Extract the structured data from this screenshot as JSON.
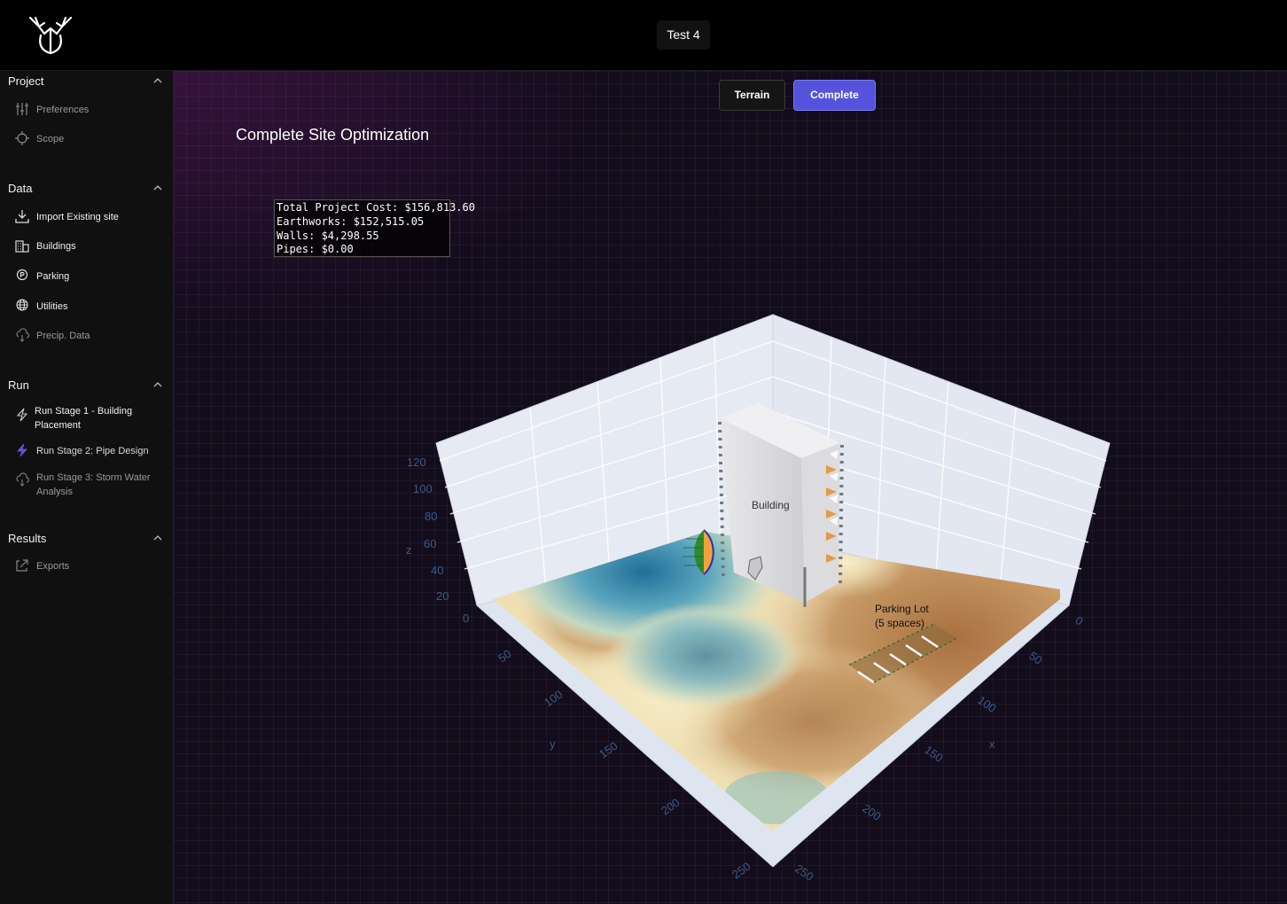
{
  "header": {
    "project_name": "Test 4"
  },
  "sidebar": {
    "sections": [
      {
        "title": "Project",
        "items": [
          {
            "label": "Preferences",
            "icon": "sliders-icon"
          },
          {
            "label": "Scope",
            "icon": "crosshair-icon"
          }
        ]
      },
      {
        "title": "Data",
        "items": [
          {
            "label": "Import Existing site",
            "icon": "download-icon"
          },
          {
            "label": "Buildings",
            "icon": "building-icon"
          },
          {
            "label": "Parking",
            "icon": "parking-icon"
          },
          {
            "label": "Utilities",
            "icon": "globe-icon"
          },
          {
            "label": "Precip. Data",
            "icon": "cloud-icon"
          }
        ]
      },
      {
        "title": "Run",
        "items": [
          {
            "label": "Run Stage 1 - Building Placement",
            "icon": "bolt-icon"
          },
          {
            "label": "Run Stage 2: Pipe Design",
            "icon": "bolt-icon"
          },
          {
            "label": "Run Stage 3: Storm Water Analysis",
            "icon": "cloud-icon"
          }
        ]
      },
      {
        "title": "Results",
        "items": [
          {
            "label": "Exports",
            "icon": "export-icon"
          }
        ]
      }
    ]
  },
  "toolbar": {
    "terrain_label": "Terrain",
    "complete_label": "Complete"
  },
  "plot": {
    "title": "Complete Site Optimization",
    "costs": {
      "total": "Total Project Cost: $156,813.60",
      "earthworks": "Earthworks: $152,515.05",
      "walls": "Walls: $4,298.55",
      "pipes": "Pipes: $0.00"
    },
    "building_label": "Building",
    "parking_label_line1": "Parking Lot",
    "parking_label_line2": "(5 spaces)",
    "axes": {
      "x_title": "x",
      "y_title": "y",
      "z_title": "z",
      "x_ticks": [
        "0",
        "50",
        "100",
        "150",
        "200",
        "250"
      ],
      "y_ticks": [
        "0",
        "50",
        "100",
        "150",
        "200",
        "250"
      ],
      "z_ticks": [
        "20",
        "40",
        "60",
        "80",
        "100",
        "120"
      ]
    },
    "colors": {
      "accent": "#5553dc",
      "water": "#2e7fa6",
      "sand": "#f0e2b6",
      "soil": "#b27d4a"
    }
  }
}
